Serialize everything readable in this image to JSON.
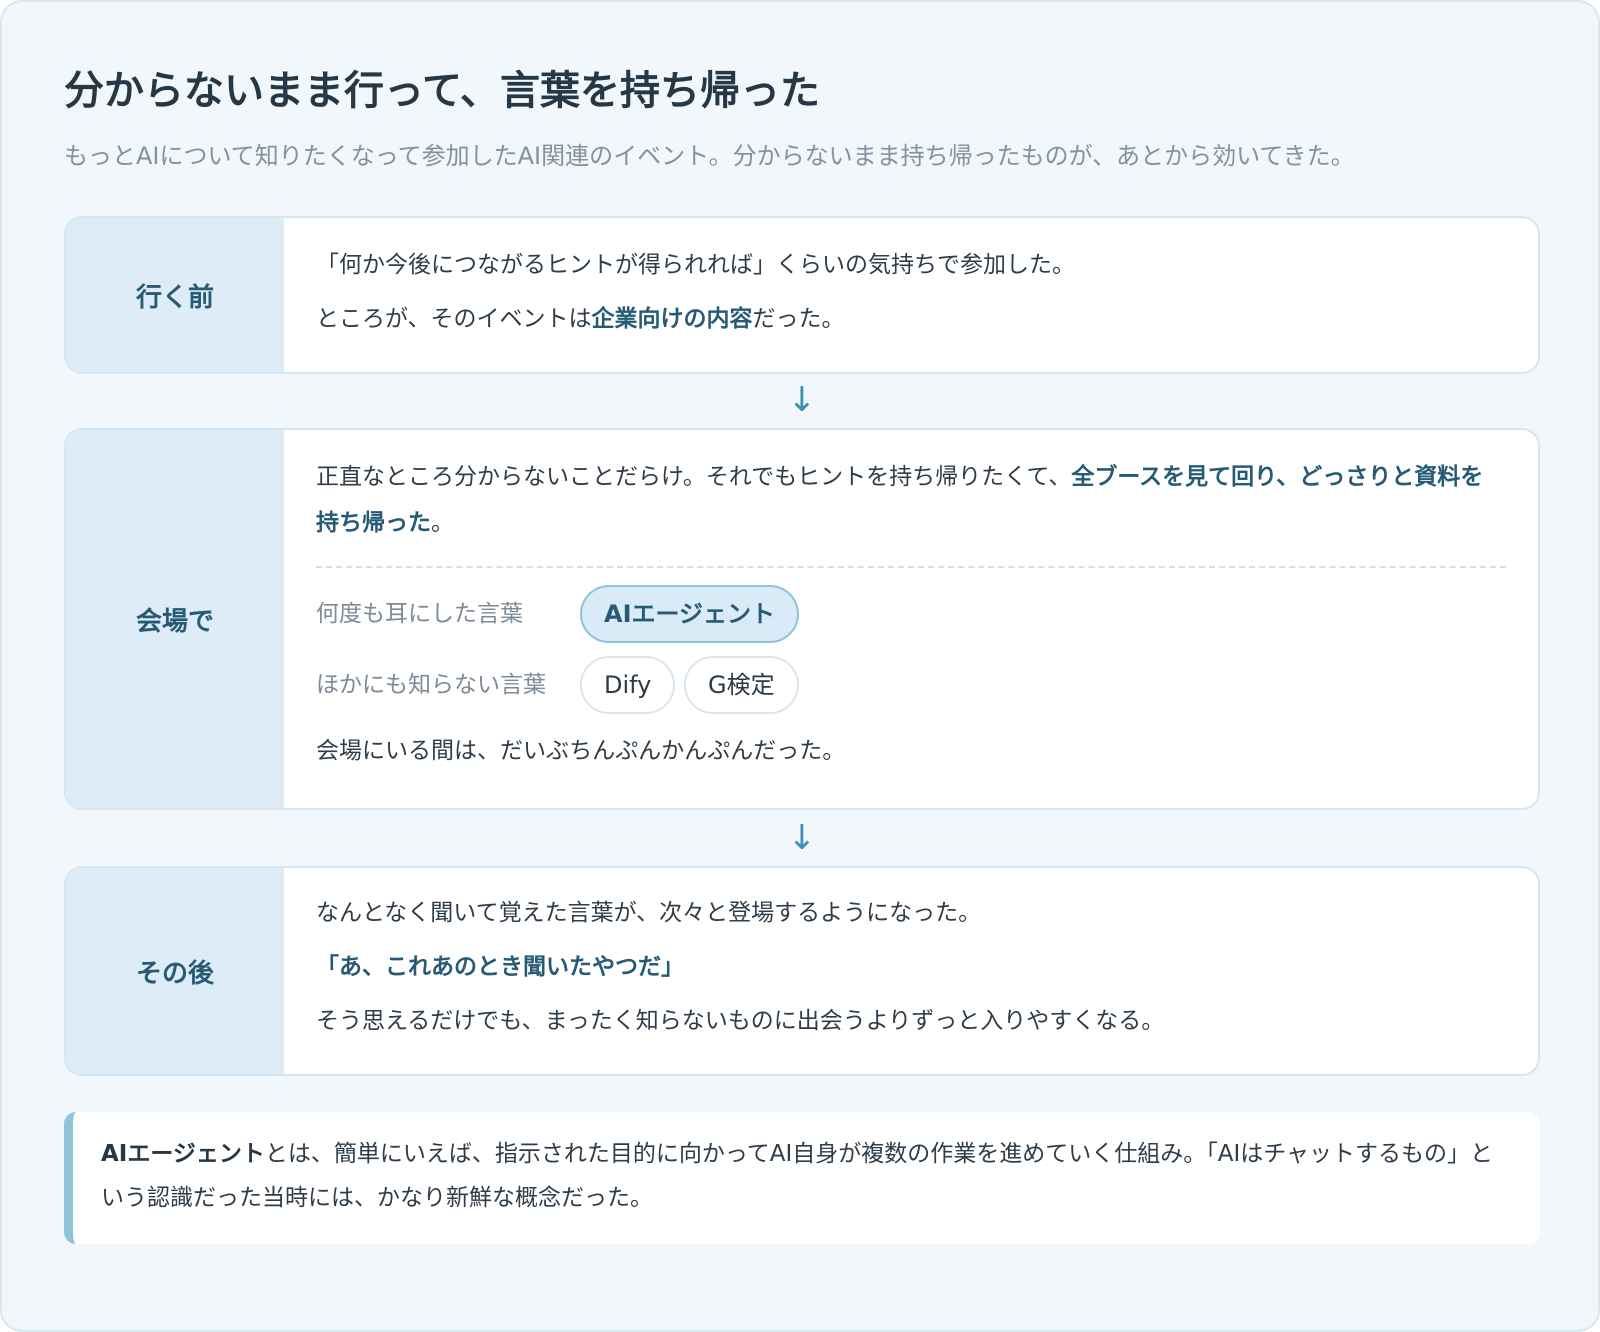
{
  "header": {
    "title": "分からないまま行って、言葉を持ち帰った",
    "subtitle": "もっとAIについて知りたくなって参加したAI関連のイベント。分からないまま持ち帰ったものが、あとから効いてきた。"
  },
  "steps": {
    "before": {
      "label": "行く前",
      "line1": "「何か今後につながるヒントが得られれば」くらいの気持ちで参加した。",
      "line2_prefix": "ところが、そのイベントは",
      "line2_emphasis": "企業向けの内容",
      "line2_suffix": "だった。"
    },
    "venue": {
      "label": "会場で",
      "line1_prefix": "正直なところ分からないことだらけ。それでもヒントを持ち帰りたくて、",
      "line1_emphasis": "全ブースを見て回り、どっさりと資料を持ち帰った",
      "line1_suffix": "。",
      "heard_label": "何度も耳にした言葉",
      "heard_term": "AIエージェント",
      "unknown_label": "ほかにも知らない言葉",
      "unknown_terms": [
        "Dify",
        "G検定"
      ],
      "closing": "会場にいる間は、だいぶちんぷんかんぷんだった。"
    },
    "after": {
      "label": "その後",
      "line1": "なんとなく聞いて覚えた言葉が、次々と登場するようになった。",
      "quote": "「あ、これあのとき聞いたやつだ」",
      "line3": "そう思えるだけでも、まったく知らないものに出会うよりずっと入りやすくなる。"
    }
  },
  "arrows": [
    "↓",
    "↓"
  ],
  "note": {
    "term": "AIエージェント",
    "text": "とは、簡単にいえば、指示された目的に向かってAI自身が複数の作業を進めていく仕組み。「AIはチャットするもの」という認識だった当時には、かなり新鮮な概念だった。"
  }
}
